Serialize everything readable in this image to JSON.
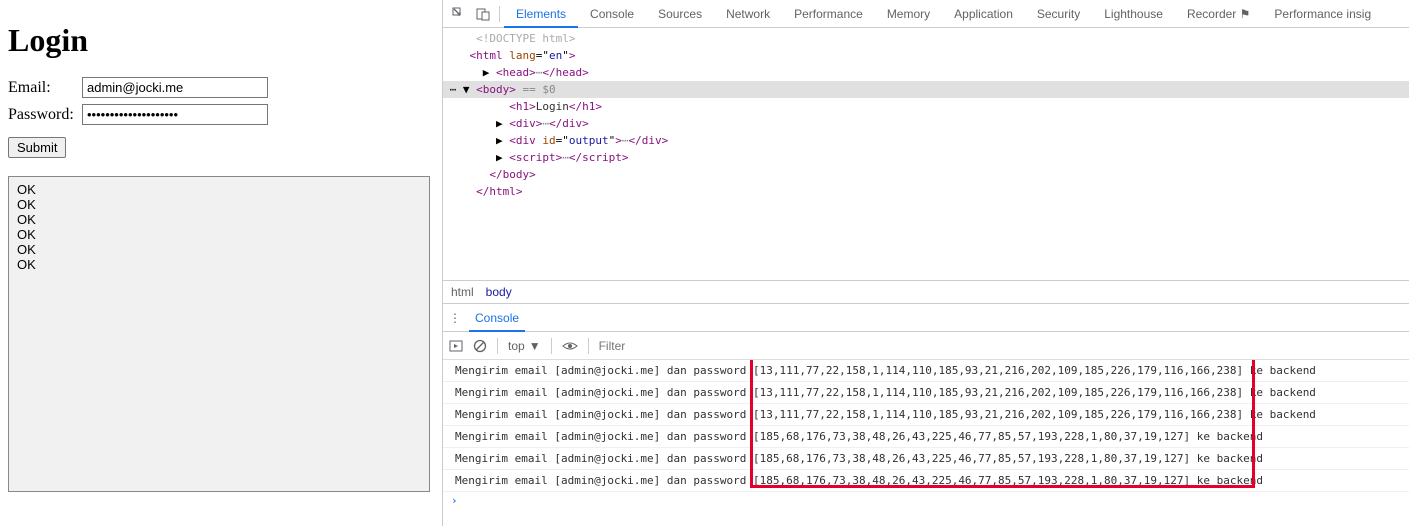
{
  "login": {
    "title": "Login",
    "emailLabel": "Email:",
    "passwordLabel": "Password:",
    "emailValue": "admin@jocki.me",
    "passwordValue": "••••••••••••••••••••",
    "submitLabel": "Submit",
    "outputLines": [
      "OK",
      "OK",
      "OK",
      "OK",
      "OK",
      "OK"
    ]
  },
  "devtools": {
    "tabs": [
      "Elements",
      "Console",
      "Sources",
      "Network",
      "Performance",
      "Memory",
      "Application",
      "Security",
      "Lighthouse",
      "Recorder ⚑",
      "Performance insig"
    ],
    "activeTab": "Elements",
    "dom": {
      "doctype": "<!DOCTYPE html>",
      "htmlOpen_lang": "en",
      "head": "head",
      "bodyOpen": "body",
      "dollar0": "== $0",
      "h1Text": "Login",
      "outputId": "output",
      "script": "script"
    },
    "breadcrumb": {
      "html": "html",
      "body": "body"
    },
    "consoleLabel": "Console",
    "consoleToolbar": {
      "top": "top",
      "filterPlaceholder": "Filter"
    },
    "consoleMessages": [
      "Mengirim email [admin@jocki.me] dan password [13,111,77,22,158,1,114,110,185,93,21,216,202,109,185,226,179,116,166,238] ke backend",
      "Mengirim email [admin@jocki.me] dan password [13,111,77,22,158,1,114,110,185,93,21,216,202,109,185,226,179,116,166,238] ke backend",
      "Mengirim email [admin@jocki.me] dan password [13,111,77,22,158,1,114,110,185,93,21,216,202,109,185,226,179,116,166,238] ke backend",
      "Mengirim email [admin@jocki.me] dan password [185,68,176,73,38,48,26,43,225,46,77,85,57,193,228,1,80,37,19,127] ke backend",
      "Mengirim email [admin@jocki.me] dan password [185,68,176,73,38,48,26,43,225,46,77,85,57,193,228,1,80,37,19,127] ke backend",
      "Mengirim email [admin@jocki.me] dan password [185,68,176,73,38,48,26,43,225,46,77,85,57,193,228,1,80,37,19,127] ke backend"
    ],
    "prompt": "›"
  }
}
